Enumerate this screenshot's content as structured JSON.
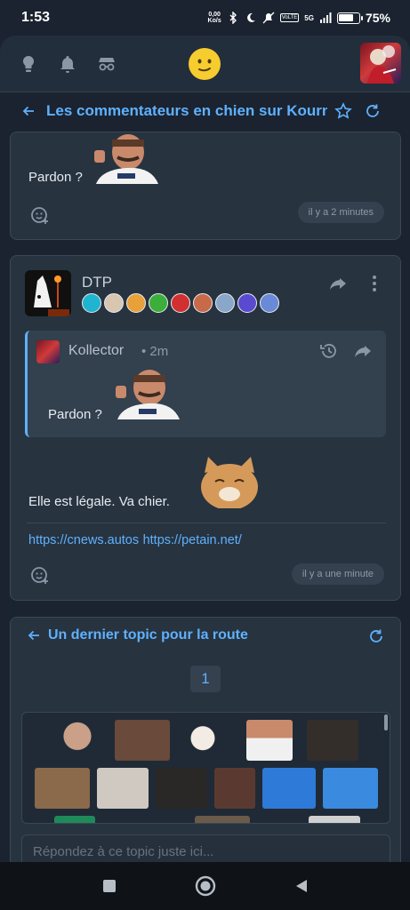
{
  "statusbar": {
    "time": "1:53",
    "net_speed_value": "0,00",
    "net_speed_unit": "Ko/s",
    "volte": "VoLTE",
    "network": "5G",
    "battery_pct": "75",
    "battery_level": 0.75
  },
  "appbar": {
    "icons": [
      "lightbulb-icon",
      "bell-icon",
      "incognito-icon",
      "smiley-icon",
      "user-avatar"
    ]
  },
  "topic": {
    "title": "Les commentateurs en chien sur Kournik"
  },
  "first_post": {
    "text": "Pardon ?",
    "time": "il y a 2 minutes"
  },
  "second_post": {
    "author": "DTP",
    "badge_count": 10,
    "quote": {
      "author": "Kollector",
      "age": "• 2m",
      "text": "Pardon ?"
    },
    "text": "Elle est légale. Va chier.",
    "links": [
      "https://cnews.autos",
      "https://petain.net/"
    ],
    "time": "il y a une minute"
  },
  "reply_card": {
    "title": "Un dernier topic pour la route",
    "page": "1",
    "placeholder": "Répondez à ce topic juste ici..."
  },
  "colors": {
    "accent": "#5fb1ff",
    "background": "#1a232f",
    "card": "#27333f"
  }
}
